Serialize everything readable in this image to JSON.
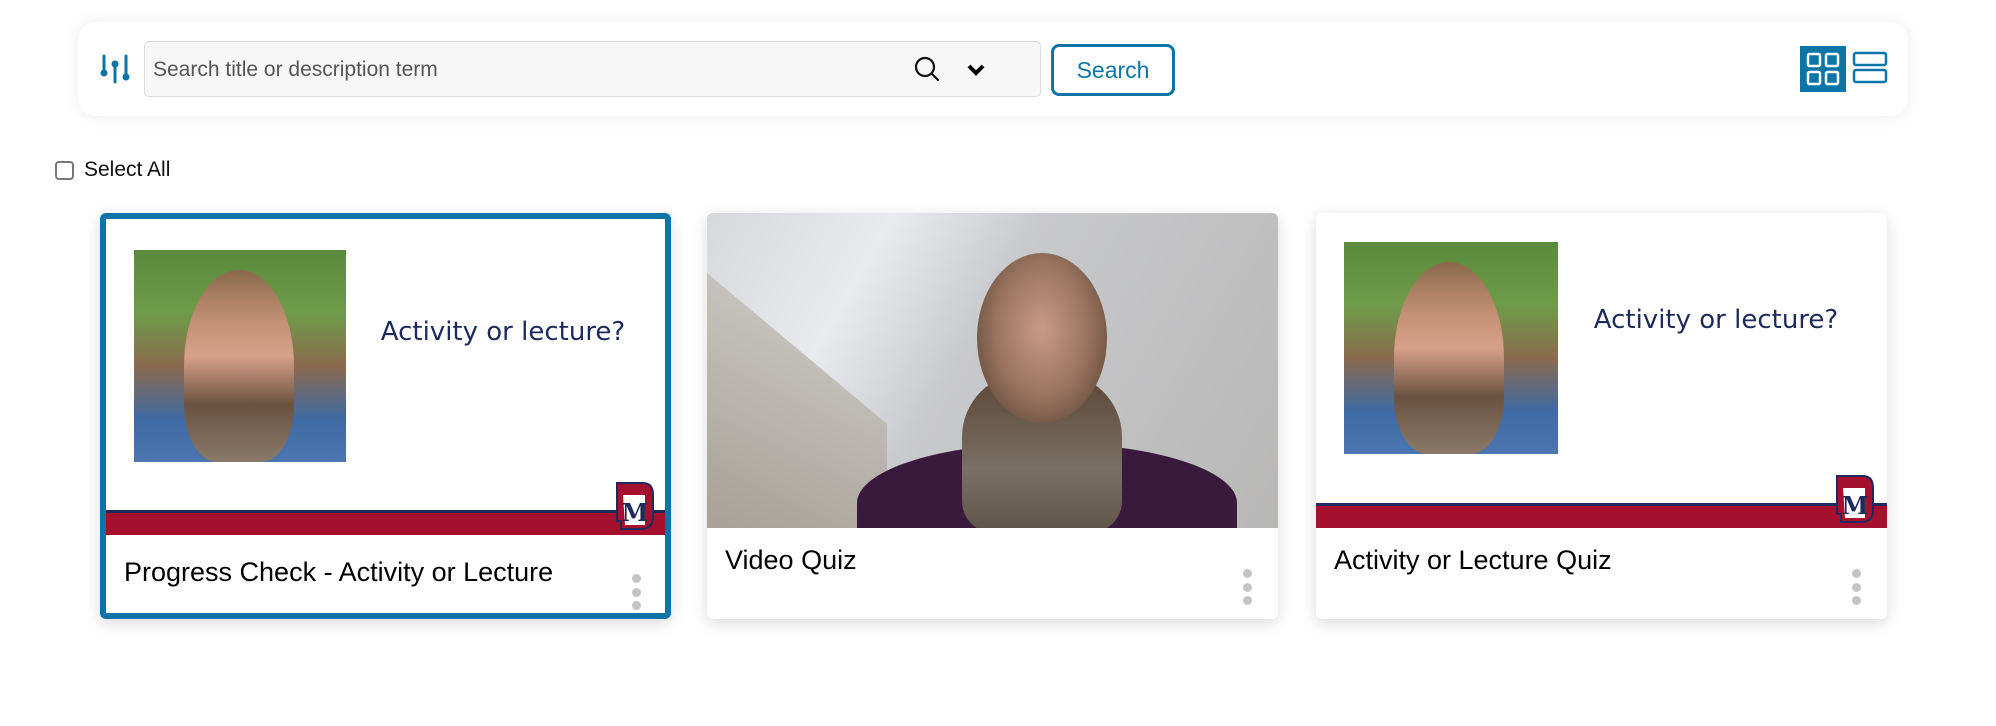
{
  "toolbar": {
    "search_placeholder": "Search title or description term",
    "search_value": "",
    "search_button_label": "Search",
    "accent_color": "#0b75a8",
    "view_modes": [
      {
        "name": "grid",
        "icon": "grid-view-icon",
        "active": true
      },
      {
        "name": "list",
        "icon": "list-view-icon",
        "active": false
      }
    ]
  },
  "select_all": {
    "label": "Select All",
    "checked": false
  },
  "cards": [
    {
      "title": "Progress Check - Activity or Lecture",
      "thumbnail_type": "slide",
      "slide_text": "Activity or lecture?",
      "selected": true
    },
    {
      "title": "Video Quiz",
      "thumbnail_type": "video",
      "selected": false
    },
    {
      "title": "Activity or Lecture Quiz",
      "thumbnail_type": "slide",
      "slide_text": "Activity or lecture?",
      "selected": false
    }
  ],
  "colors": {
    "stripe_red": "#a6102f",
    "stripe_navy": "#1f2a5c",
    "slide_text": "#1f2a5c"
  }
}
